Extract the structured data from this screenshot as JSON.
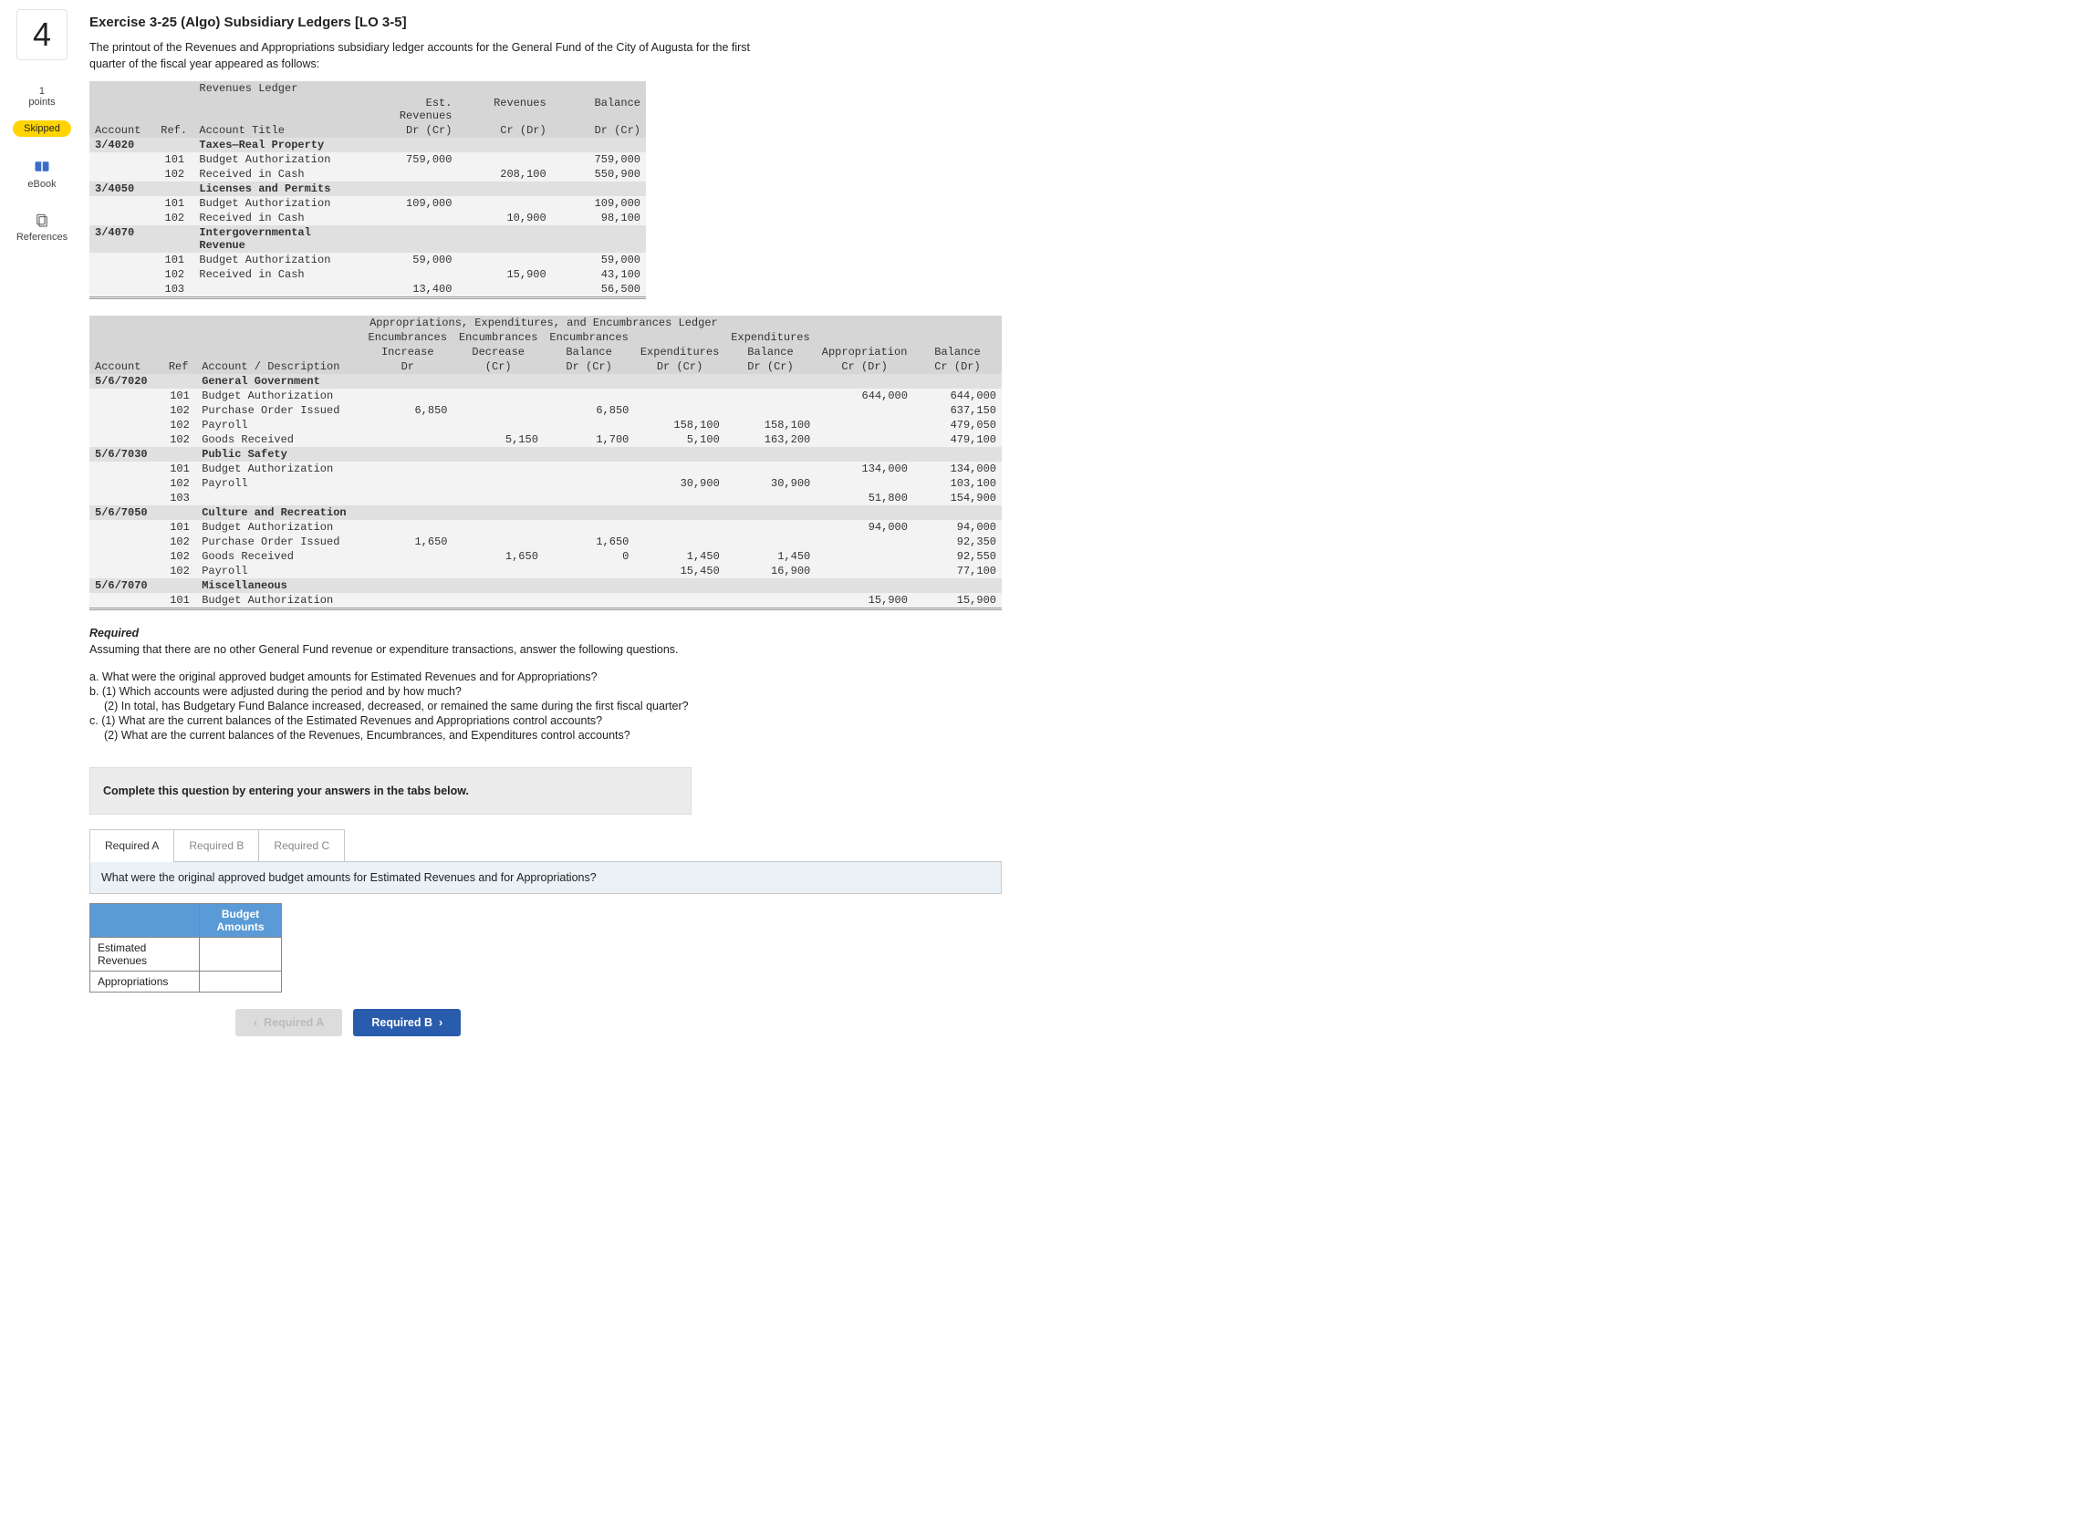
{
  "sidebar": {
    "question_number": "4",
    "points_value": "1",
    "points_label": "points",
    "skipped_label": "Skipped",
    "ebook_label": "eBook",
    "references_label": "References"
  },
  "title": "Exercise 3-25 (Algo) Subsidiary Ledgers [LO 3-5]",
  "intro_line1": "The printout of the Revenues and Appropriations subsidiary ledger accounts for the General Fund of the City of Augusta for the first",
  "intro_line2": "quarter of the fiscal year appeared as follows:",
  "rev_ledger": {
    "title": "Revenues Ledger",
    "cols": {
      "account": "Account",
      "ref": "Ref.",
      "acct_title": "Account Title",
      "est_rev": "Est. Revenues",
      "est_rev_sub": "Dr (Cr)",
      "revenues": "Revenues",
      "revenues_sub": "Cr (Dr)",
      "balance": "Balance",
      "balance_sub": "Dr (Cr)"
    },
    "groups": [
      {
        "account": "3/4020",
        "name": "Taxes—Real Property",
        "rows": [
          {
            "ref": "101",
            "desc": "Budget Authorization",
            "est": "759,000",
            "rev": "",
            "bal": "759,000"
          },
          {
            "ref": "102",
            "desc": "Received in Cash",
            "est": "",
            "rev": "208,100",
            "bal": "550,900"
          }
        ]
      },
      {
        "account": "3/4050",
        "name": "Licenses and Permits",
        "rows": [
          {
            "ref": "101",
            "desc": "Budget Authorization",
            "est": "109,000",
            "rev": "",
            "bal": "109,000"
          },
          {
            "ref": "102",
            "desc": "Received in Cash",
            "est": "",
            "rev": "10,900",
            "bal": "98,100"
          }
        ]
      },
      {
        "account": "3/4070",
        "name": "Intergovernmental Revenue",
        "rows": [
          {
            "ref": "101",
            "desc": "Budget Authorization",
            "est": "59,000",
            "rev": "",
            "bal": "59,000"
          },
          {
            "ref": "102",
            "desc": "Received in Cash",
            "est": "",
            "rev": "15,900",
            "bal": "43,100"
          },
          {
            "ref": "103",
            "desc": "",
            "est": "13,400",
            "rev": "",
            "bal": "56,500"
          }
        ]
      }
    ]
  },
  "app_ledger": {
    "title": "Appropriations, Expenditures, and Encumbrances Ledger",
    "cols": {
      "account": "Account",
      "ref": "Ref",
      "desc": "Account / Description",
      "enc_inc": "Encumbrances",
      "enc_inc_sub": "Increase",
      "enc_inc_sub2": "Dr",
      "enc_dec": "Encumbrances",
      "enc_dec_sub": "Decrease",
      "enc_dec_sub2": "(Cr)",
      "enc_bal": "Encumbrances",
      "enc_bal_sub": "Balance",
      "enc_bal_sub2": "Dr (Cr)",
      "exp": "Expenditures",
      "exp_sub": "Dr (Cr)",
      "exp_bal": "Expenditures",
      "exp_bal_sub": "Balance",
      "exp_bal_sub2": "Dr (Cr)",
      "appr": "Appropriation",
      "appr_sub": "Cr (Dr)",
      "bal": "Balance",
      "bal_sub": "Cr (Dr)"
    },
    "groups": [
      {
        "account": "5/6/7020",
        "name": "General Government",
        "rows": [
          {
            "ref": "101",
            "desc": "Budget Authorization",
            "ei": "",
            "ed": "",
            "eb": "",
            "ex": "",
            "exb": "",
            "ap": "644,000",
            "bal": "644,000"
          },
          {
            "ref": "102",
            "desc": "Purchase Order Issued",
            "ei": "6,850",
            "ed": "",
            "eb": "6,850",
            "ex": "",
            "exb": "",
            "ap": "",
            "bal": "637,150"
          },
          {
            "ref": "102",
            "desc": "Payroll",
            "ei": "",
            "ed": "",
            "eb": "",
            "ex": "158,100",
            "exb": "158,100",
            "ap": "",
            "bal": "479,050"
          },
          {
            "ref": "102",
            "desc": "Goods Received",
            "ei": "",
            "ed": "5,150",
            "eb": "1,700",
            "ex": "5,100",
            "exb": "163,200",
            "ap": "",
            "bal": "479,100"
          }
        ]
      },
      {
        "account": "5/6/7030",
        "name": "Public Safety",
        "rows": [
          {
            "ref": "101",
            "desc": "Budget Authorization",
            "ei": "",
            "ed": "",
            "eb": "",
            "ex": "",
            "exb": "",
            "ap": "134,000",
            "bal": "134,000"
          },
          {
            "ref": "102",
            "desc": "Payroll",
            "ei": "",
            "ed": "",
            "eb": "",
            "ex": "30,900",
            "exb": "30,900",
            "ap": "",
            "bal": "103,100"
          },
          {
            "ref": "103",
            "desc": "",
            "ei": "",
            "ed": "",
            "eb": "",
            "ex": "",
            "exb": "",
            "ap": "51,800",
            "bal": "154,900"
          }
        ]
      },
      {
        "account": "5/6/7050",
        "name": "Culture and Recreation",
        "rows": [
          {
            "ref": "101",
            "desc": "Budget Authorization",
            "ei": "",
            "ed": "",
            "eb": "",
            "ex": "",
            "exb": "",
            "ap": "94,000",
            "bal": "94,000"
          },
          {
            "ref": "102",
            "desc": "Purchase Order Issued",
            "ei": "1,650",
            "ed": "",
            "eb": "1,650",
            "ex": "",
            "exb": "",
            "ap": "",
            "bal": "92,350"
          },
          {
            "ref": "102",
            "desc": "Goods Received",
            "ei": "",
            "ed": "1,650",
            "eb": "0",
            "ex": "1,450",
            "exb": "1,450",
            "ap": "",
            "bal": "92,550"
          },
          {
            "ref": "102",
            "desc": "Payroll",
            "ei": "",
            "ed": "",
            "eb": "",
            "ex": "15,450",
            "exb": "16,900",
            "ap": "",
            "bal": "77,100"
          }
        ]
      },
      {
        "account": "5/6/7070",
        "name": "Miscellaneous",
        "rows": [
          {
            "ref": "101",
            "desc": "Budget Authorization",
            "ei": "",
            "ed": "",
            "eb": "",
            "ex": "",
            "exb": "",
            "ap": "15,900",
            "bal": "15,900"
          }
        ]
      }
    ]
  },
  "required": {
    "heading": "Required",
    "lead": "Assuming that there are no other General Fund revenue or expenditure transactions, answer the following questions.",
    "a": "a. What were the original approved budget amounts for Estimated Revenues and for Appropriations?",
    "b1": "b. (1) Which accounts were adjusted during the period and by how much?",
    "b2": "(2) In total, has Budgetary Fund Balance increased, decreased, or remained the same during the first fiscal quarter?",
    "c1": "c. (1) What are the current balances of the Estimated Revenues and Appropriations control accounts?",
    "c2": "(2) What are the current balances of the Revenues, Encumbrances, and Expenditures control accounts?"
  },
  "answer": {
    "box_text": "Complete this question by entering your answers in the tabs below.",
    "tabs": {
      "a": "Required A",
      "b": "Required B",
      "c": "Required C"
    },
    "prompt": "What were the original approved budget amounts for Estimated Revenues and for Appropriations?",
    "table": {
      "col_header": "Budget Amounts",
      "row1": "Estimated Revenues",
      "row2": "Appropriations"
    },
    "nav": {
      "prev": "Required A",
      "next": "Required B"
    }
  }
}
